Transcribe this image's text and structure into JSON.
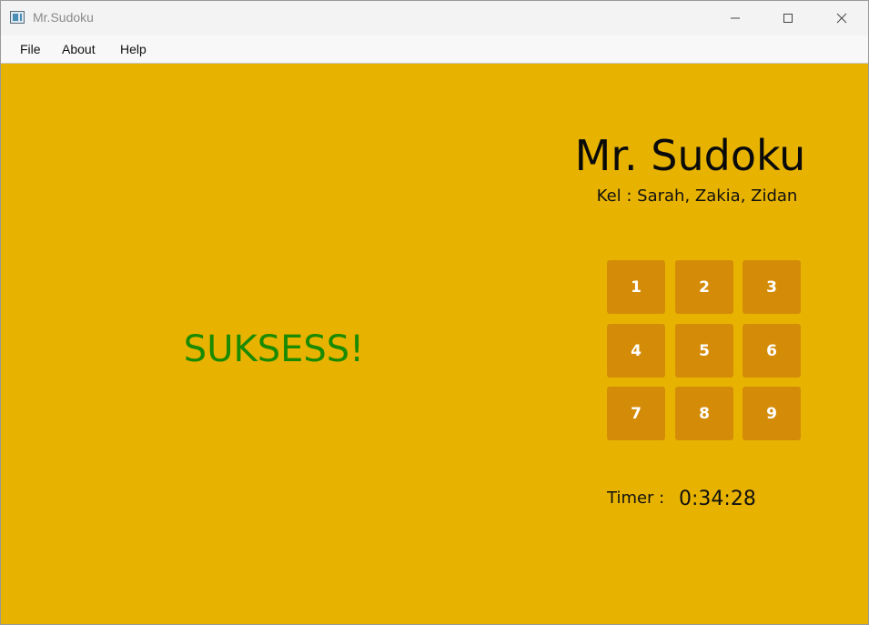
{
  "window": {
    "title": "Mr.Sudoku",
    "icon": "app-window-icon",
    "controls": [
      "minimize-icon",
      "maximize-icon",
      "close-icon"
    ]
  },
  "menu": {
    "items": [
      {
        "label": "File"
      },
      {
        "label": "About"
      },
      {
        "label": "Help"
      }
    ]
  },
  "main": {
    "status": "SUKSESS!",
    "status_color": "#1a8a00",
    "background_color": "#e8b300",
    "title": "Mr. Sudoku",
    "subtitle": "Kel : Sarah, Zakia, Zidan",
    "numpad": [
      "1",
      "2",
      "3",
      "4",
      "5",
      "6",
      "7",
      "8",
      "9"
    ],
    "numpad_color": "#d48c08",
    "timer_label": "Timer :",
    "timer_value": "0:34:28"
  }
}
